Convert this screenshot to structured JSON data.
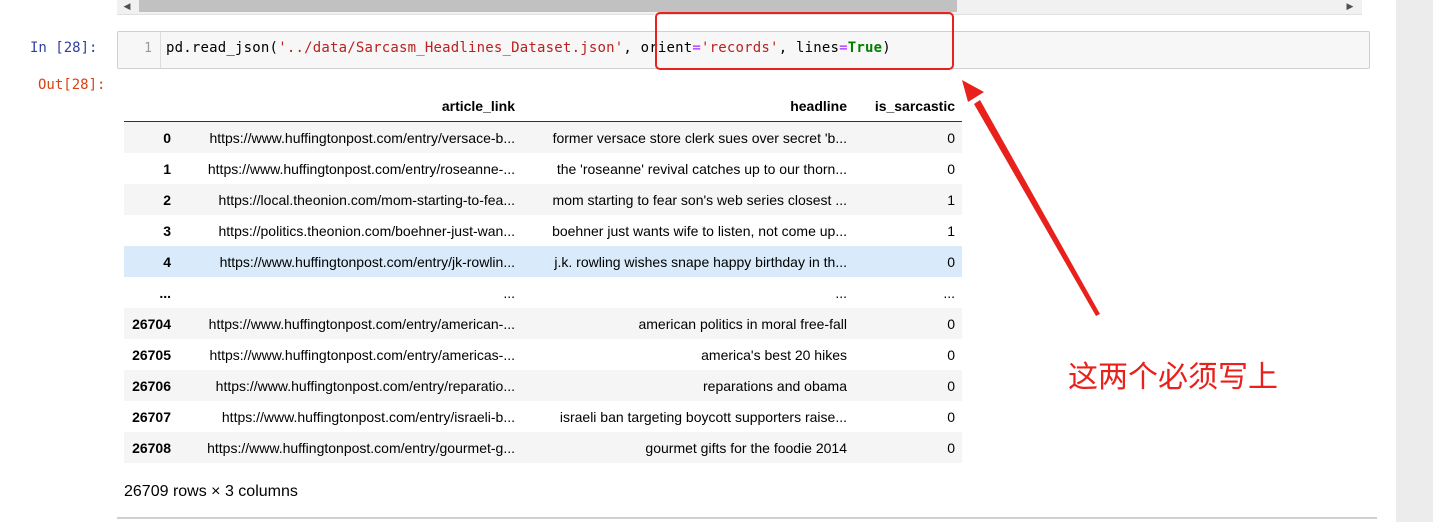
{
  "colors": {
    "annotation_red": "#e8211c",
    "prompt_in": "#303f9f",
    "prompt_out": "#d84315",
    "row_highlight": "#d9ebfa"
  },
  "scrollbar": {
    "left_arrow": "◀",
    "right_arrow": "▶"
  },
  "cell": {
    "in_prompt": "In  [28]:",
    "out_prompt": "Out[28]:",
    "line_number": "1",
    "code": {
      "t1": "pd.read_json(",
      "t2": "'../data/Sarcasm_Headlines_Dataset.json'",
      "t3": ", orient",
      "t4": "=",
      "t5": "'records'",
      "t6": ", lines",
      "t7": "=",
      "t8": "True",
      "t9": ")"
    }
  },
  "dataframe": {
    "columns": [
      "",
      "article_link",
      "headline",
      "is_sarcastic"
    ],
    "rows": [
      {
        "index": "0",
        "article_link": "https://www.huffingtonpost.com/entry/versace-b...",
        "headline": "former versace store clerk sues over secret 'b...",
        "is_sarcastic": "0"
      },
      {
        "index": "1",
        "article_link": "https://www.huffingtonpost.com/entry/roseanne-...",
        "headline": "the 'roseanne' revival catches up to our thorn...",
        "is_sarcastic": "0"
      },
      {
        "index": "2",
        "article_link": "https://local.theonion.com/mom-starting-to-fea...",
        "headline": "mom starting to fear son's web series closest ...",
        "is_sarcastic": "1"
      },
      {
        "index": "3",
        "article_link": "https://politics.theonion.com/boehner-just-wan...",
        "headline": "boehner just wants wife to listen, not come up...",
        "is_sarcastic": "1"
      },
      {
        "index": "4",
        "article_link": "https://www.huffingtonpost.com/entry/jk-rowlin...",
        "headline": "j.k. rowling wishes snape happy birthday in th...",
        "is_sarcastic": "0"
      },
      {
        "index": "...",
        "article_link": "...",
        "headline": "...",
        "is_sarcastic": "..."
      },
      {
        "index": "26704",
        "article_link": "https://www.huffingtonpost.com/entry/american-...",
        "headline": "american politics in moral free-fall",
        "is_sarcastic": "0"
      },
      {
        "index": "26705",
        "article_link": "https://www.huffingtonpost.com/entry/americas-...",
        "headline": "america's best 20 hikes",
        "is_sarcastic": "0"
      },
      {
        "index": "26706",
        "article_link": "https://www.huffingtonpost.com/entry/reparatio...",
        "headline": "reparations and obama",
        "is_sarcastic": "0"
      },
      {
        "index": "26707",
        "article_link": "https://www.huffingtonpost.com/entry/israeli-b...",
        "headline": "israeli ban targeting boycott supporters raise...",
        "is_sarcastic": "0"
      },
      {
        "index": "26708",
        "article_link": "https://www.huffingtonpost.com/entry/gourmet-g...",
        "headline": "gourmet gifts for the foodie 2014",
        "is_sarcastic": "0"
      }
    ],
    "shape_text": "26709 rows × 3 columns"
  },
  "annotation": {
    "text": "这两个必须写上"
  }
}
